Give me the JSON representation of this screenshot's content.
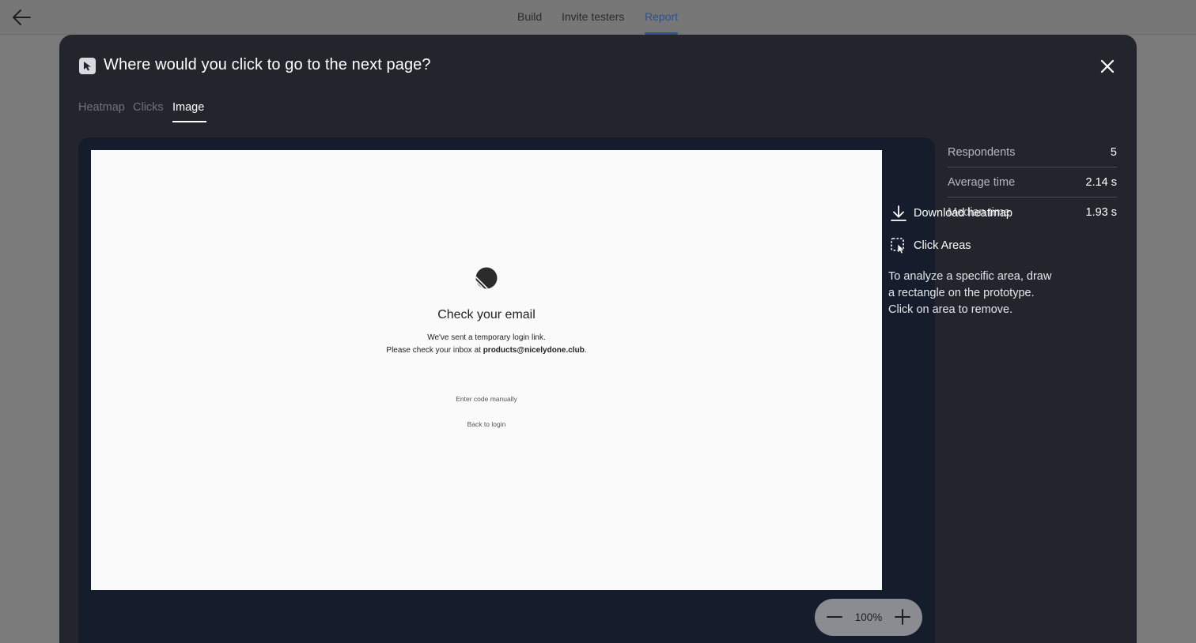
{
  "topbar": {
    "back_icon": "arrow-left-icon",
    "tabs": [
      "Build",
      "Invite testers",
      "Report"
    ],
    "active_tab": "Report",
    "accent_color": "#2d4f8f"
  },
  "modal": {
    "icon": "cursor-click-icon",
    "title": "Where would you click to go to the next page?",
    "close_icon": "close-icon",
    "tabs": [
      "Heatmap",
      "Clicks",
      "Image"
    ],
    "active_tab": "Image"
  },
  "prototype": {
    "logo_icon": "striped-circle-logo",
    "heading": "Check your email",
    "line1": "We've sent a temporary login link.",
    "line2_prefix": "Please check your inbox at ",
    "line2_email": "products@nicelydone.club",
    "line2_suffix": ".",
    "link_enter_code": "Enter code manually",
    "link_back": "Back to login"
  },
  "zoom": {
    "value": "100%",
    "minus_icon": "minus-icon",
    "plus_icon": "plus-icon"
  },
  "stats": [
    {
      "label": "Respondents",
      "value": "5"
    },
    {
      "label": "Average time",
      "value": "2.14 s"
    },
    {
      "label": "Median time",
      "value": "1.93 s"
    }
  ],
  "actions": {
    "download_label": "Download heatmap",
    "download_icon": "download-icon",
    "areas_label": "Click Areas",
    "areas_icon": "click-area-icon"
  },
  "help_text": "To analyze a specific area, draw a rectangle on the prototype. Click on area to remove."
}
